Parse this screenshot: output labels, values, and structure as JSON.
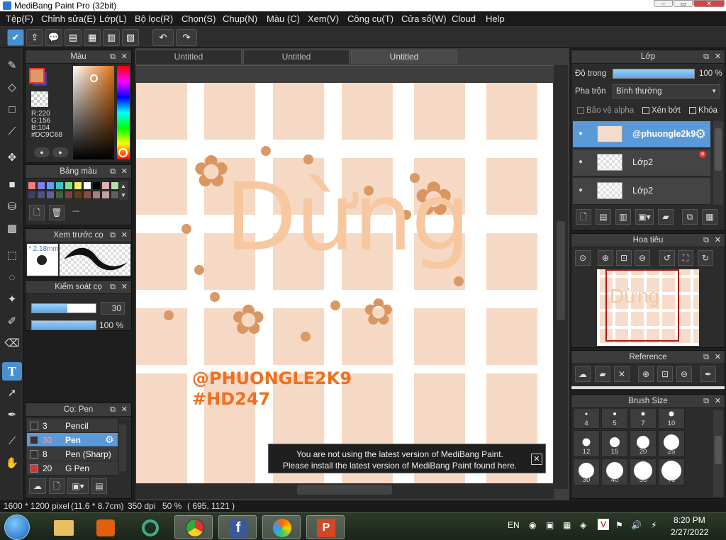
{
  "window": {
    "title": "MediBang Paint Pro (32bit)"
  },
  "menu": [
    "Tệp(F)",
    "Chỉnh sửa(E)",
    "Lớp(L)",
    "Bộ lọc(R)",
    "Chọn(S)",
    "Chụp(N)",
    "Màu (C)",
    "Xem(V)",
    "Công cụ(T)",
    "Cửa sổ(W)",
    "Cloud",
    "Help"
  ],
  "tabs": [
    "Untitled",
    "Untitled",
    "Untitled"
  ],
  "color_panel": {
    "title": "Màu",
    "r": "R:220",
    "g": "G:156",
    "b": "B:104",
    "hex": "#DC9C68",
    "primary": "#dc9c68",
    "secondary": "#3344aa"
  },
  "palette_panel": {
    "title": "Bảng màu",
    "value": "---",
    "swatches": [
      "#f08080",
      "#8080f0",
      "#60a0f0",
      "#40c0c0",
      "#80e080",
      "#f0f060",
      "#ffffff",
      "#000000",
      "#e0b0b0",
      "#b0e0b0",
      "#404060",
      "#505080",
      "#6060a0",
      "#406040",
      "#804040",
      "#604020",
      "#805040",
      "#a08080",
      "#c0a0a0",
      "#606060"
    ]
  },
  "preview_panel": {
    "title": "Xem trước cọ",
    "size": "* 2.18mm"
  },
  "brush_control": {
    "title": "Kiểm soát cọ",
    "size": "30",
    "opacity": "100 %"
  },
  "brush_panel": {
    "title": "Cọ: Pen",
    "items": [
      {
        "size": "3",
        "name": "Pencil",
        "color": "#333333",
        "selected": false
      },
      {
        "size": "30",
        "name": "Pen",
        "color": "#333333",
        "selected": true
      },
      {
        "size": "8",
        "name": "Pen (Sharp)",
        "color": "#333333",
        "selected": false
      },
      {
        "size": "20",
        "name": "G Pen",
        "color": "#e03030",
        "selected": false
      }
    ]
  },
  "layer_panel": {
    "title": "Lớp",
    "opacity_label": "Độ trong",
    "opacity_value": "100 %",
    "blend_label": "Pha trộn",
    "blend_value": "Bình thường",
    "protect_alpha": "Bảo vệ alpha",
    "clip": "Xén bớt",
    "lock": "Khóa",
    "layers": [
      {
        "name": "@phuongle2k9"
      },
      {
        "name": "Lớp2"
      },
      {
        "name": "Lớp2"
      }
    ]
  },
  "navigator": {
    "title": "Hoa tiêu"
  },
  "reference": {
    "title": "Reference"
  },
  "brush_size": {
    "title": "Brush Size",
    "sizes": [
      "4",
      "5",
      "7",
      "10",
      "12",
      "15",
      "20",
      "25",
      "30",
      "40",
      "50",
      "70"
    ]
  },
  "artwork": {
    "main_text": "Dừng",
    "handle": "@PHUONGLE2K9",
    "tag": "#HD247"
  },
  "notification": {
    "line1": "You are not using the latest version of MediBang Paint.",
    "line2": "Please install the latest version of MediBang Paint found here."
  },
  "status": {
    "size": "1600 * 1200 pixel",
    "physical": "(11.6 * 8.7cm)",
    "dpi": "350 dpi",
    "zoom": "50 %",
    "coords": "( 695, 1121 )"
  },
  "taskbar": {
    "lang": "EN",
    "time": "8:20 PM",
    "date": "2/27/2022"
  }
}
